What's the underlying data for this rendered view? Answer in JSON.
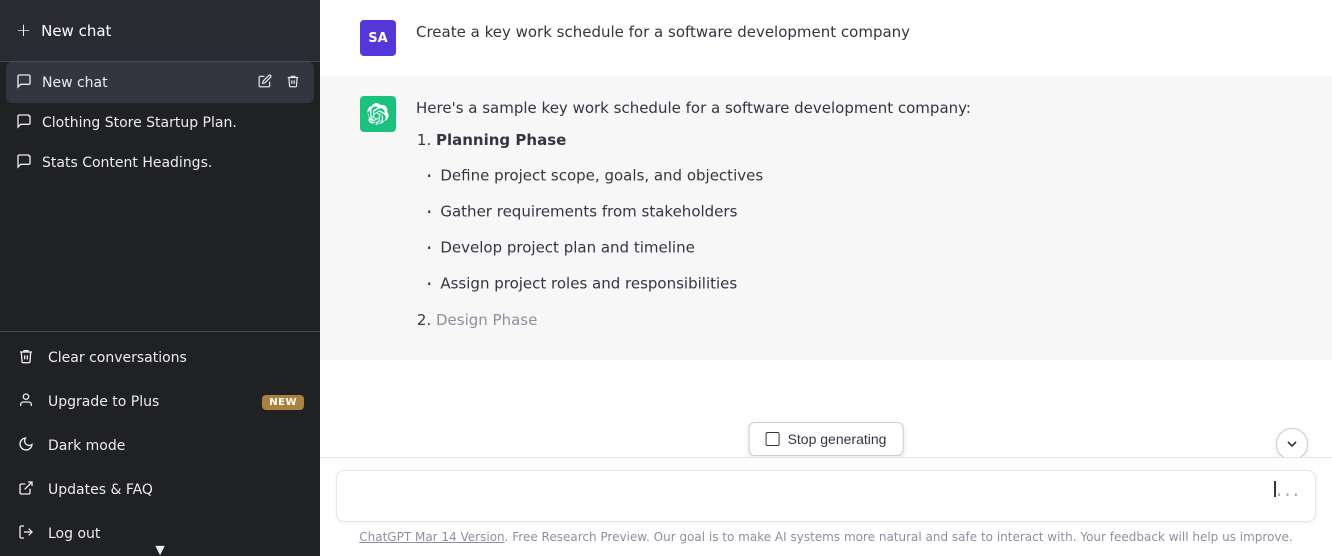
{
  "sidebar": {
    "new_chat_top_label": "New chat",
    "new_chat_top_icon": "+",
    "scroll_up_icon": "▲",
    "scroll_down_icon": "▼",
    "chat_items": [
      {
        "id": "active",
        "label": "New chat",
        "icon": "💬",
        "active": true
      },
      {
        "id": "clothing",
        "label": "Clothing Store Startup Plan.",
        "icon": "💬",
        "active": false
      },
      {
        "id": "stats",
        "label": "Stats Content Headings.",
        "icon": "💬",
        "active": false
      }
    ],
    "actions": [
      {
        "id": "clear",
        "label": "Clear conversations",
        "icon": "🗑"
      },
      {
        "id": "upgrade",
        "label": "Upgrade to Plus",
        "icon": "👤",
        "badge": "NEW"
      },
      {
        "id": "dark",
        "label": "Dark mode",
        "icon": "🌙"
      },
      {
        "id": "updates",
        "label": "Updates & FAQ",
        "icon": "↗"
      },
      {
        "id": "logout",
        "label": "Log out",
        "icon": "→"
      }
    ]
  },
  "chat": {
    "user_initials": "SA",
    "user_message": "Create a key work schedule for a software development company",
    "assistant_intro": "Here's a sample key work schedule for a software development company:",
    "planning_phase_label": "Planning Phase",
    "planning_items": [
      "Define project scope, goals, and objectives",
      "Gather requirements from stakeholders",
      "Develop project plan and timeline",
      "Assign project roles and responsibilities"
    ],
    "design_phase_label": "Design Phase",
    "stop_btn_label": "Stop generating",
    "scroll_down_icon": "⌄",
    "input_placeholder": "",
    "input_dots": "···",
    "footer_link_text": "ChatGPT Mar 14 Version",
    "footer_text": ". Free Research Preview. Our goal is to make AI systems more natural and safe to interact with. Your feedback will help us improve."
  }
}
